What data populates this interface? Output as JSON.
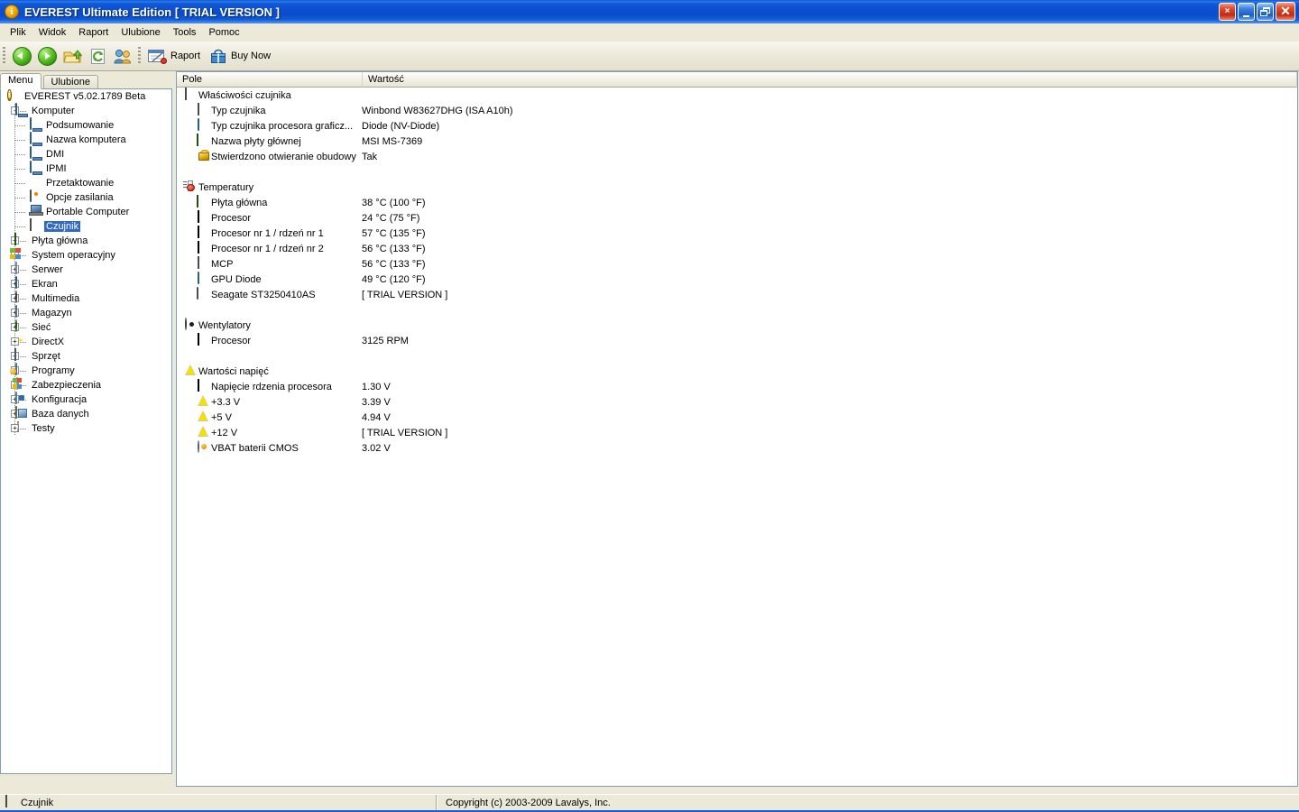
{
  "window": {
    "title": "EVEREST Ultimate Edition  [ TRIAL VERSION ]",
    "app_icon": "info-icon",
    "icon_letter": "i",
    "buttons": [
      {
        "name": "mdi-close-button",
        "label": "×"
      },
      {
        "name": "minimize-button",
        "label": ""
      },
      {
        "name": "restore-button",
        "label": ""
      },
      {
        "name": "close-button",
        "label": "✕"
      }
    ],
    "accent_color": "#0a4ccb",
    "highlight_color": "#316ac5"
  },
  "menubar": {
    "items": [
      "Plik",
      "Widok",
      "Raport",
      "Ulubione",
      "Tools",
      "Pomoc"
    ]
  },
  "toolbar": {
    "back_label": "",
    "forward_label": "",
    "report_label": "Raport",
    "buy_label": "Buy Now",
    "icons": [
      "back-arrow-icon",
      "forward-arrow-icon",
      "open-folder-icon",
      "refresh-icon",
      "users-icon",
      "report-icon",
      "buy-now-icon"
    ]
  },
  "sidebar": {
    "tabs": [
      {
        "label": "Menu",
        "active": true
      },
      {
        "label": "Ulubione",
        "active": false
      }
    ],
    "tree": [
      {
        "label": "EVEREST v5.02.1789 Beta",
        "icon": "info-icon",
        "level": 0,
        "expander": "",
        "selected": false
      },
      {
        "label": "Komputer",
        "icon": "computer-icon",
        "level": 1,
        "expander": "-",
        "selected": false
      },
      {
        "label": "Podsumowanie",
        "icon": "computer-icon",
        "level": 2,
        "expander": "",
        "selected": false
      },
      {
        "label": "Nazwa komputera",
        "icon": "computer-icon",
        "level": 2,
        "expander": "",
        "selected": false
      },
      {
        "label": "DMI",
        "icon": "computer-icon",
        "level": 2,
        "expander": "",
        "selected": false
      },
      {
        "label": "IPMI",
        "icon": "computer-icon",
        "level": 2,
        "expander": "",
        "selected": false
      },
      {
        "label": "Przetaktowanie",
        "icon": "fire-icon",
        "level": 2,
        "expander": "",
        "selected": false
      },
      {
        "label": "Opcje zasilania",
        "icon": "power-icon",
        "level": 2,
        "expander": "",
        "selected": false
      },
      {
        "label": "Portable Computer",
        "icon": "laptop-icon",
        "level": 2,
        "expander": "",
        "selected": false
      },
      {
        "label": "Czujnik",
        "icon": "sensor-chip-icon",
        "level": 2,
        "expander": "",
        "selected": true
      },
      {
        "label": "Płyta główna",
        "icon": "motherboard-icon",
        "level": 1,
        "expander": "+",
        "selected": false
      },
      {
        "label": "System operacyjny",
        "icon": "windows-icon",
        "level": 1,
        "expander": "+",
        "selected": false
      },
      {
        "label": "Serwer",
        "icon": "server-icon",
        "level": 1,
        "expander": "+",
        "selected": false
      },
      {
        "label": "Ekran",
        "icon": "monitor-icon",
        "level": 1,
        "expander": "+",
        "selected": false
      },
      {
        "label": "Multimedia",
        "icon": "speaker-icon",
        "level": 1,
        "expander": "+",
        "selected": false
      },
      {
        "label": "Magazyn",
        "icon": "disk-icon",
        "level": 1,
        "expander": "+",
        "selected": false
      },
      {
        "label": "Sieć",
        "icon": "globe-icon",
        "level": 1,
        "expander": "+",
        "selected": false
      },
      {
        "label": "DirectX",
        "icon": "directx-icon",
        "level": 1,
        "expander": "+",
        "selected": false
      },
      {
        "label": "Sprzęt",
        "icon": "hardware-icon",
        "level": 1,
        "expander": "+",
        "selected": false
      },
      {
        "label": "Programy",
        "icon": "programs-icon",
        "level": 1,
        "expander": "+",
        "selected": false
      },
      {
        "label": "Zabezpieczenia",
        "icon": "shield-icon",
        "level": 1,
        "expander": "+",
        "selected": false
      },
      {
        "label": "Konfiguracja",
        "icon": "config-icon",
        "level": 1,
        "expander": "+",
        "selected": false
      },
      {
        "label": "Baza danych",
        "icon": "database-icon",
        "level": 1,
        "expander": "+",
        "selected": false
      },
      {
        "label": "Testy",
        "icon": "hourglass-icon",
        "level": 1,
        "expander": "+",
        "selected": false
      }
    ]
  },
  "content": {
    "columns": [
      {
        "label": "Pole"
      },
      {
        "label": "Wartość"
      }
    ],
    "rows": [
      {
        "kind": "group",
        "icon": "sensor-chip-icon",
        "field": "Właściwości czujnika",
        "value": ""
      },
      {
        "kind": "item",
        "icon": "sensor-chip-icon",
        "field": "Typ czujnika",
        "value": "Winbond W83627DHG  (ISA A10h)"
      },
      {
        "kind": "item",
        "icon": "monitor-icon",
        "field": "Typ czujnika procesora graficz...",
        "value": "Diode  (NV-Diode)"
      },
      {
        "kind": "item",
        "icon": "motherboard-icon",
        "field": "Nazwa płyty głównej",
        "value": "MSI MS-7369"
      },
      {
        "kind": "item",
        "icon": "lock-icon",
        "field": "Stwierdzono otwieranie obudowy",
        "value": "Tak"
      },
      {
        "kind": "spacer"
      },
      {
        "kind": "group",
        "icon": "thermometer-icon",
        "field": "Temperatury",
        "value": ""
      },
      {
        "kind": "item",
        "icon": "motherboard-icon",
        "field": "Płyta główna",
        "value": "38 °C  (100 °F)"
      },
      {
        "kind": "item",
        "icon": "cpu-icon",
        "field": "Procesor",
        "value": "24 °C  (75 °F)"
      },
      {
        "kind": "item",
        "icon": "cpu-icon",
        "field": "Procesor nr 1 / rdzeń nr 1",
        "value": "57 °C  (135 °F)"
      },
      {
        "kind": "item",
        "icon": "cpu-icon",
        "field": "Procesor nr 1 / rdzeń nr 2",
        "value": "56 °C  (133 °F)"
      },
      {
        "kind": "item",
        "icon": "sensor-chip-icon",
        "field": "MCP",
        "value": "56 °C  (133 °F)"
      },
      {
        "kind": "item",
        "icon": "monitor-icon",
        "field": "GPU Diode",
        "value": "49 °C  (120 °F)"
      },
      {
        "kind": "item",
        "icon": "hdd-icon",
        "field": "Seagate ST3250410AS",
        "value": "[ TRIAL VERSION ]"
      },
      {
        "kind": "spacer"
      },
      {
        "kind": "group",
        "icon": "fan-icon",
        "field": "Wentylatory",
        "value": ""
      },
      {
        "kind": "item",
        "icon": "cpu-icon",
        "field": "Procesor",
        "value": "3125 RPM"
      },
      {
        "kind": "spacer"
      },
      {
        "kind": "group",
        "icon": "voltage-icon",
        "field": "Wartości napięć",
        "value": ""
      },
      {
        "kind": "item",
        "icon": "cpu-icon",
        "field": "Napięcie rdzenia procesora",
        "value": "1.30 V"
      },
      {
        "kind": "item",
        "icon": "voltage-icon",
        "field": "+3.3 V",
        "value": "3.39 V"
      },
      {
        "kind": "item",
        "icon": "voltage-icon",
        "field": "+5 V",
        "value": "4.94 V"
      },
      {
        "kind": "item",
        "icon": "voltage-icon",
        "field": "+12 V",
        "value": "[ TRIAL VERSION ]"
      },
      {
        "kind": "item",
        "icon": "battery-icon",
        "field": "VBAT baterii CMOS",
        "value": "3.02 V"
      }
    ]
  },
  "statusbar": {
    "left_text": "Czujnik",
    "left_icon": "sensor-chip-icon",
    "right_text": "Copyright (c) 2003-2009 Lavalys, Inc."
  }
}
